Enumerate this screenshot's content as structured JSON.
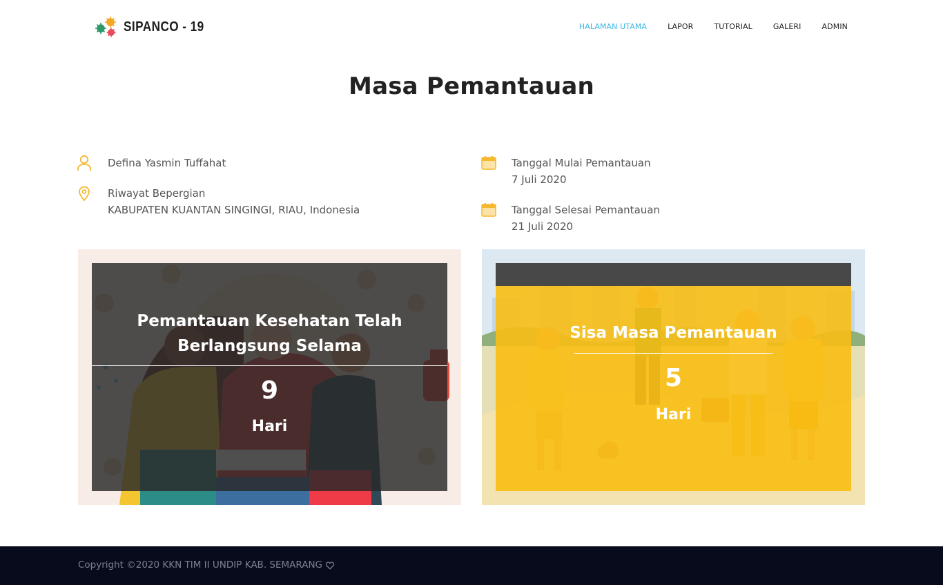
{
  "brand": {
    "name": "SIPANCO - 19",
    "logo_icon": "virus-cluster-icon"
  },
  "nav": {
    "items": [
      {
        "label": "HALAMAN UTAMA",
        "active": true
      },
      {
        "label": "LAPOR",
        "active": false
      },
      {
        "label": "TUTORIAL",
        "active": false
      },
      {
        "label": "GALERI",
        "active": false
      },
      {
        "label": "ADMIN",
        "active": false
      }
    ]
  },
  "page": {
    "title": "Masa Pemantauan"
  },
  "info": {
    "name": {
      "icon": "user-icon",
      "value": "Defina Yasmin Tuffahat"
    },
    "travel": {
      "icon": "map-pin-icon",
      "label": "Riwayat Bepergian",
      "value": "KABUPATEN KUANTAN SINGINGI, RIAU, Indonesia"
    },
    "start": {
      "icon": "calendar-icon",
      "label": "Tanggal Mulai Pemantauan",
      "value": "7 Juli 2020"
    },
    "end": {
      "icon": "calendar-icon",
      "label": "Tanggal Selesai Pemantauan",
      "value": "21 Juli 2020"
    }
  },
  "cards": {
    "elapsed": {
      "heading_line1": "Pemantauan Kesehatan Telah",
      "heading_line2": "Berlangsung Selama",
      "number": "9",
      "unit": "Hari"
    },
    "remaining": {
      "heading": "Sisa Masa Pemantauan",
      "number": "5",
      "unit": "Hari"
    }
  },
  "footer": {
    "copyright": "Copyright ©2020 KKN TIM II UNDIP KAB. SEMARANG",
    "icon": "heart-icon"
  },
  "colors": {
    "accent": "#3bb7e6",
    "icon": "#f5b82e",
    "overlay_dark": "#333333",
    "overlay_yellow": "#f8be14",
    "footer_bg": "#070b1c"
  }
}
